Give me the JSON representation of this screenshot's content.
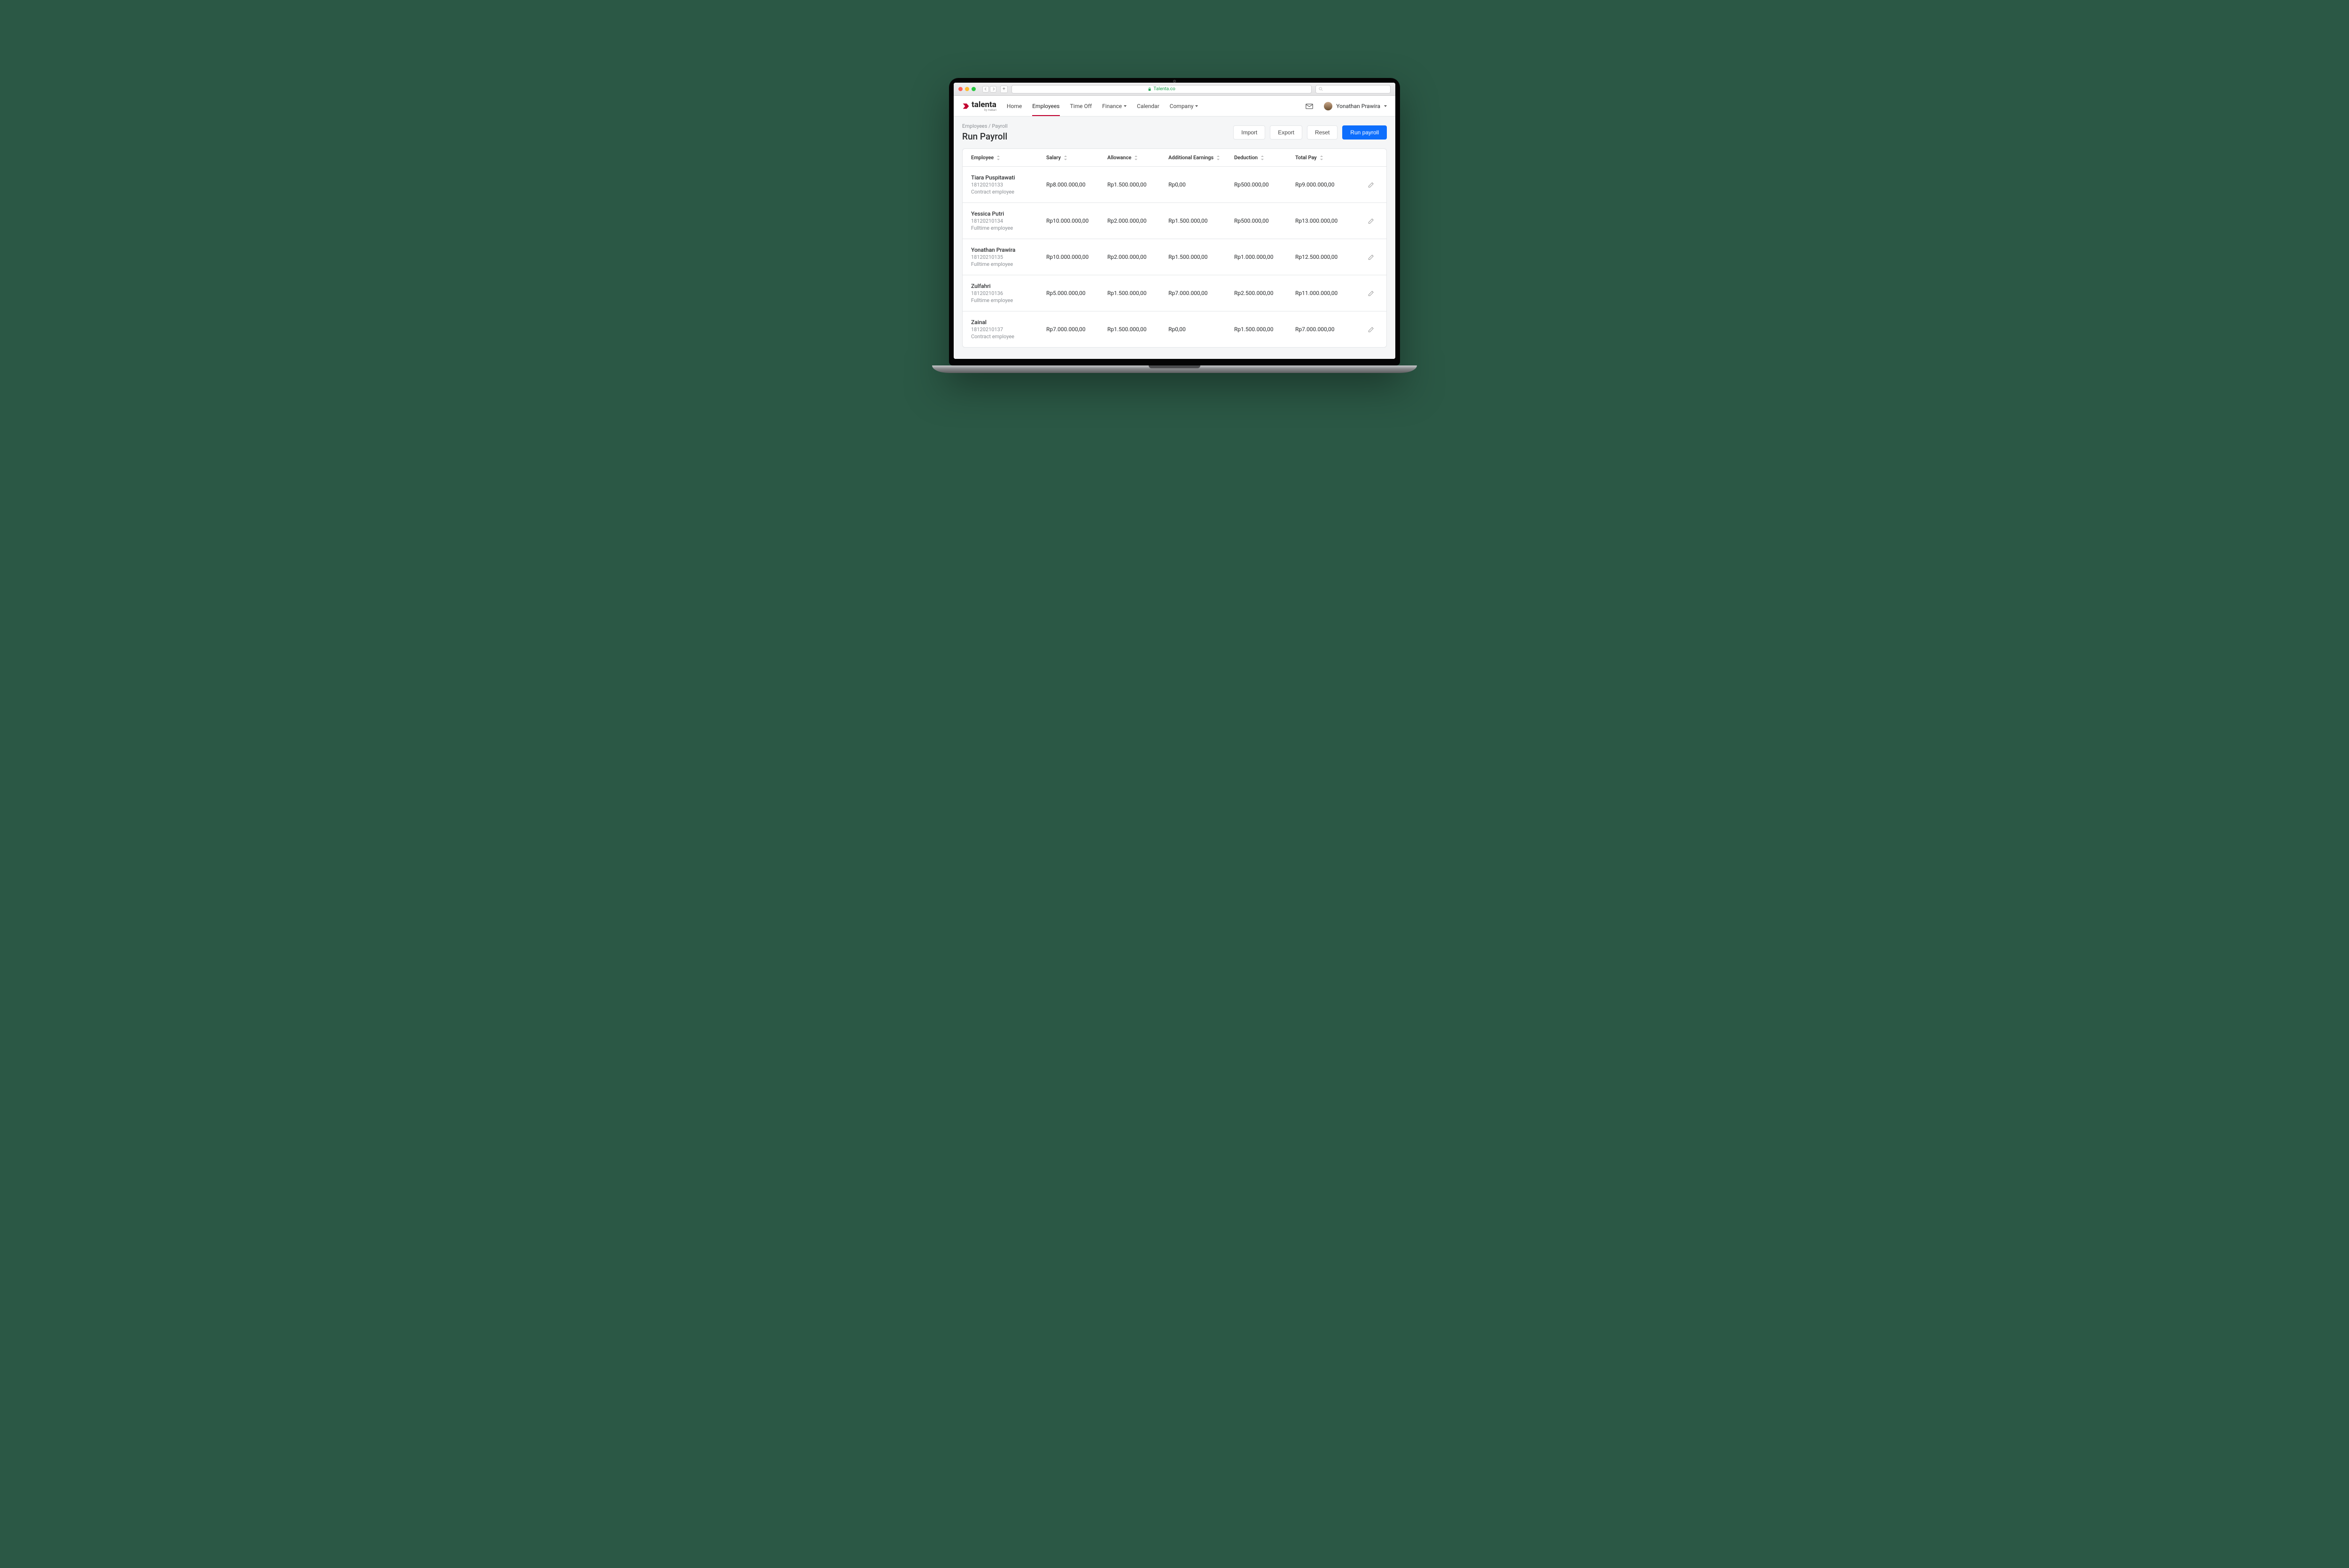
{
  "browser": {
    "url_label": "Talenta.co"
  },
  "brand": {
    "name": "talenta",
    "tagline": "by mekari"
  },
  "nav": {
    "items": [
      {
        "label": "Home"
      },
      {
        "label": "Employees"
      },
      {
        "label": "Time Off"
      },
      {
        "label": "Finance",
        "dropdown": true
      },
      {
        "label": "Calendar"
      },
      {
        "label": "Company",
        "dropdown": true
      }
    ],
    "active_index": 1
  },
  "user": {
    "name": "Yonathan Prawira"
  },
  "breadcrumb": "Employees / Payroll",
  "page_title": "Run Payroll",
  "actions": {
    "import": "Import",
    "export": "Export",
    "reset": "Reset",
    "run": "Run payroll"
  },
  "columns": {
    "employee": "Employee",
    "salary": "Salary",
    "allowance": "Allowance",
    "additional": "Additional Earnings",
    "deduction": "Deduction",
    "total": "Total Pay"
  },
  "rows": [
    {
      "name": "Tiara Puspitawati",
      "id": "18120210133",
      "type": "Contract employee",
      "salary": "Rp8.000.000,00",
      "allowance": "Rp1.500.000,00",
      "additional": "Rp0,00",
      "deduction": "Rp500.000,00",
      "total": "Rp9.000.000,00"
    },
    {
      "name": "Yessica Putri",
      "id": "18120210134",
      "type": "Fulltime employee",
      "salary": "Rp10.000.000,00",
      "allowance": "Rp2.000.000,00",
      "additional": "Rp1.500.000,00",
      "deduction": "Rp500.000,00",
      "total": "Rp13.000.000,00"
    },
    {
      "name": "Yonathan Prawira",
      "id": "18120210135",
      "type": "Fulltime employee",
      "salary": "Rp10.000.000,00",
      "allowance": "Rp2.000.000,00",
      "additional": "Rp1.500.000,00",
      "deduction": "Rp1.000.000,00",
      "total": "Rp12.500.000,00"
    },
    {
      "name": "Zulfahri",
      "id": "18120210136",
      "type": "Fulltime employee",
      "salary": "Rp5.000.000,00",
      "allowance": "Rp1.500.000,00",
      "additional": "Rp7.000.000,00",
      "deduction": "Rp2.500.000,00",
      "total": "Rp11.000.000,00"
    },
    {
      "name": "Zainal",
      "id": "18120210137",
      "type": "Contract employee",
      "salary": "Rp7.000.000,00",
      "allowance": "Rp1.500.000,00",
      "additional": "Rp0,00",
      "deduction": "Rp1.500.000,00",
      "total": "Rp7.000.000,00"
    }
  ]
}
